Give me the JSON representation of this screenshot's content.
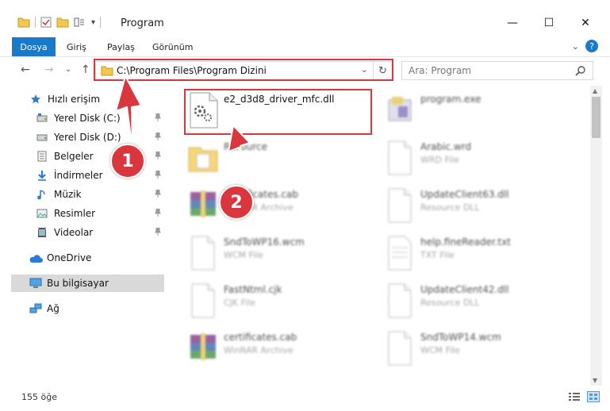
{
  "window": {
    "title": "Program",
    "qa_dropdown": "▾",
    "minimize": "—",
    "maximize": "☐",
    "close": "✕"
  },
  "ribbon": {
    "file_tab": "Dosya",
    "tabs": [
      "Giriş",
      "Paylaş",
      "Görünüm"
    ],
    "expand": "⌄",
    "help": "?"
  },
  "nav": {
    "back": "←",
    "forward": "→",
    "recent": "⌄",
    "up": "↑",
    "address": "C:\\Program Files\\Program Dizini",
    "address_dropdown": "⌄",
    "refresh": "↻",
    "search_placeholder": "Ara: Program"
  },
  "sidebar": {
    "quick_access": "Hızlı erişim",
    "items": [
      {
        "label": "Yerel Disk (C:)",
        "icon": "drive-icon"
      },
      {
        "label": "Yerel Disk (D:)",
        "icon": "drive-icon"
      },
      {
        "label": "Belgeler",
        "icon": "documents-icon"
      },
      {
        "label": "İndirmeler",
        "icon": "downloads-icon"
      },
      {
        "label": "Müzik",
        "icon": "music-icon"
      },
      {
        "label": "Resimler",
        "icon": "pictures-icon"
      },
      {
        "label": "Videolar",
        "icon": "videos-icon"
      }
    ],
    "onedrive": "OneDrive",
    "this_pc": "Bu bilgisayar",
    "network": "Ağ"
  },
  "files": {
    "left": [
      {
        "name": "e2_d3d8_driver_mfc.dll",
        "type": "",
        "icon": "dll-gear-icon",
        "blur": false
      },
      {
        "name": "Resource",
        "type": "",
        "icon": "folder-icon",
        "blur": true
      },
      {
        "name": "Certificates.cab",
        "type": "WinRAR Archive",
        "icon": "winrar-icon",
        "blur": true
      },
      {
        "name": "SndToWP16.wcm",
        "type": "WCM File",
        "icon": "file-icon",
        "blur": true
      },
      {
        "name": "FastNtml.cjk",
        "type": "CJK File",
        "icon": "file-icon",
        "blur": true
      },
      {
        "name": "certificates.cab",
        "type": "WinRAR Archive",
        "icon": "winrar-icon",
        "blur": true
      }
    ],
    "right": [
      {
        "name": "program.exe",
        "type": "",
        "icon": "exe-icon",
        "blur": true
      },
      {
        "name": "Arabic.wrd",
        "type": "WRD File",
        "icon": "file-icon",
        "blur": true
      },
      {
        "name": "UpdateClient63.dll",
        "type": "Resource DLL",
        "icon": "file-icon",
        "blur": true
      },
      {
        "name": "help.fineReader.txt",
        "type": "TXT File",
        "icon": "text-file-icon",
        "blur": true
      },
      {
        "name": "UpdateClient42.dll",
        "type": "Resource DLL",
        "icon": "file-icon",
        "blur": true
      },
      {
        "name": "SndToWP14.wcm",
        "type": "WCM File",
        "icon": "file-icon",
        "blur": true
      }
    ]
  },
  "status": {
    "count": "155 öğe"
  },
  "callouts": [
    "1",
    "2"
  ],
  "colors": {
    "accent": "#1979ca",
    "highlight": "#d9363e",
    "folder": "#f3c84f"
  }
}
